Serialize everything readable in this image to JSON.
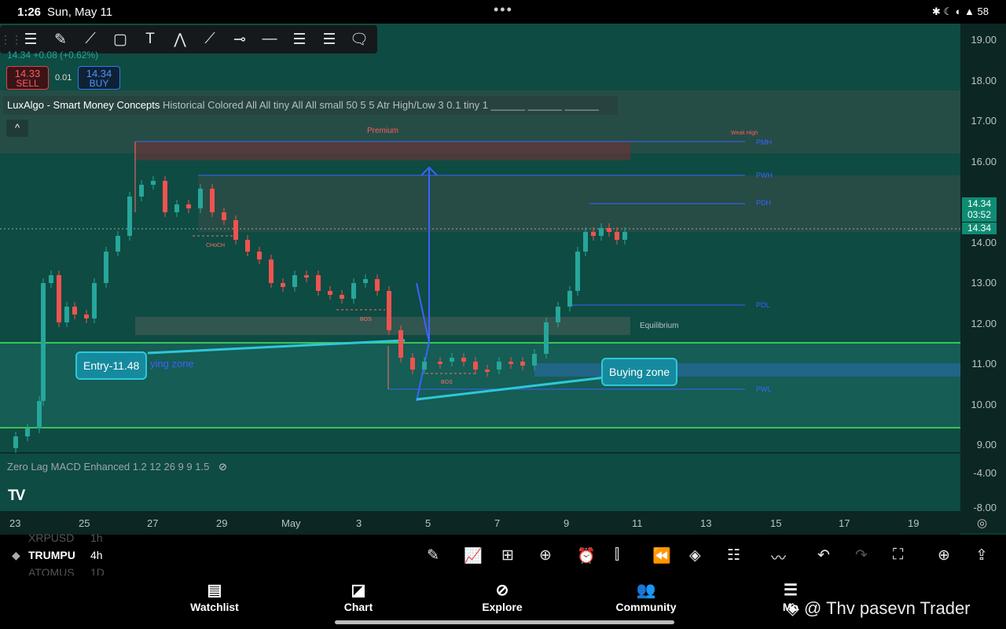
{
  "status_bar": {
    "time": "1:26",
    "date": "Sun, May 11",
    "icons": "✱ ☾ ◐ ▲ 58"
  },
  "drawing_toolbar": {
    "tools": [
      {
        "name": "lines-menu-icon",
        "glyph": "☰"
      },
      {
        "name": "brush-icon",
        "glyph": "✎"
      },
      {
        "name": "trend-icon",
        "glyph": "⟋"
      },
      {
        "name": "rectangle-icon",
        "glyph": "▢"
      },
      {
        "name": "text-icon",
        "glyph": "T"
      },
      {
        "name": "pattern-icon",
        "glyph": "⋀"
      },
      {
        "name": "ray-icon",
        "glyph": "⟋"
      },
      {
        "name": "horizontal-ray-icon",
        "glyph": "⊸"
      },
      {
        "name": "horizontal-line-icon",
        "glyph": "—"
      },
      {
        "name": "parallel-channel-icon",
        "glyph": "☰"
      },
      {
        "name": "fib-icon",
        "glyph": "☰"
      },
      {
        "name": "callout-icon",
        "glyph": "🗨"
      }
    ]
  },
  "quote": {
    "price": "14.34",
    "change": "+0.08 (+0.62%)",
    "sell_price": "14.33",
    "sell_label": "SELL",
    "lot": "0.01",
    "buy_price": "14.34",
    "buy_label": "BUY"
  },
  "indicator_main": {
    "name": "LuxAlgo - Smart Money Concepts",
    "params": "Historical Colored All All tiny All All small 50 5 5 Atr High/Low 3 0.1 tiny 1 ______ ______ ______"
  },
  "indicator_macd": {
    "name": "Zero Lag MACD Enhanced",
    "params": "1.2 12 26 9 9 1.5"
  },
  "chart_labels": {
    "premium": "Premium",
    "weak_high": "Weak High",
    "pmh": "PMH",
    "pwh": "PWH",
    "pdh": "PDH",
    "pdl": "PDL",
    "pwl": "PWL",
    "equilibrium": "Equilibrium",
    "choch": "CHoCH",
    "bos1": "BOS",
    "bos2": "BOS",
    "entry": "Entry-11.48",
    "buying_zone_partial": "ying zone",
    "buying_zone": "Buying zone"
  },
  "price_axis": [
    "19.00",
    "18.00",
    "17.00",
    "16.00",
    "15.00",
    "14.00",
    "13.00",
    "12.00",
    "11.00",
    "10.00",
    "9.00",
    "-4.00",
    "-8.00"
  ],
  "price_badges": {
    "last": "14.34",
    "countdown": "03:52",
    "bid": "14.34"
  },
  "time_axis": [
    "23",
    "25",
    "27",
    "29",
    "May",
    "3",
    "5",
    "7",
    "9",
    "11",
    "13",
    "15",
    "17",
    "19"
  ],
  "symbols": [
    {
      "name": "XRPUSD",
      "tf": "1h"
    },
    {
      "name": "TRUMPU",
      "tf": "4h"
    },
    {
      "name": "ATOMUS",
      "tf": "1D"
    }
  ],
  "bottom_tools": [
    {
      "name": "draw-pen-icon",
      "glyph": "✎"
    },
    {
      "name": "indicators-icon",
      "glyph": "📈"
    },
    {
      "name": "templates-icon",
      "glyph": "⊞"
    },
    {
      "name": "add-icon",
      "glyph": "⊕"
    },
    {
      "name": "alert-clock-icon",
      "glyph": "⏰"
    },
    {
      "name": "candles-icon",
      "glyph": "⫿"
    },
    {
      "name": "replay-icon",
      "glyph": "⏪"
    },
    {
      "name": "layers-icon",
      "glyph": "◈"
    },
    {
      "name": "settings-sliders-icon",
      "glyph": "☷"
    },
    {
      "name": "compare-icon",
      "glyph": "〰"
    },
    {
      "name": "undo-icon",
      "glyph": "↶"
    },
    {
      "name": "redo-icon",
      "glyph": "↷"
    },
    {
      "name": "fullscreen-icon",
      "glyph": "⛶"
    },
    {
      "name": "crosshair-icon",
      "glyph": "⊕"
    },
    {
      "name": "share-icon",
      "glyph": "⇪"
    }
  ],
  "nav": [
    {
      "label": "Watchlist",
      "icon": "▤"
    },
    {
      "label": "Chart",
      "icon": "◪"
    },
    {
      "label": "Explore",
      "icon": "⊘"
    },
    {
      "label": "Community",
      "icon": "👥"
    },
    {
      "label": "Mo",
      "icon": "☰"
    }
  ],
  "watermark": "◈ @ Thv pasevn Trader",
  "colors": {
    "up": "#26a69a",
    "down": "#ef5350",
    "zone_green": "#3cc25a",
    "level_blue": "#3a63ff",
    "accent_teal": "#158a9e"
  }
}
